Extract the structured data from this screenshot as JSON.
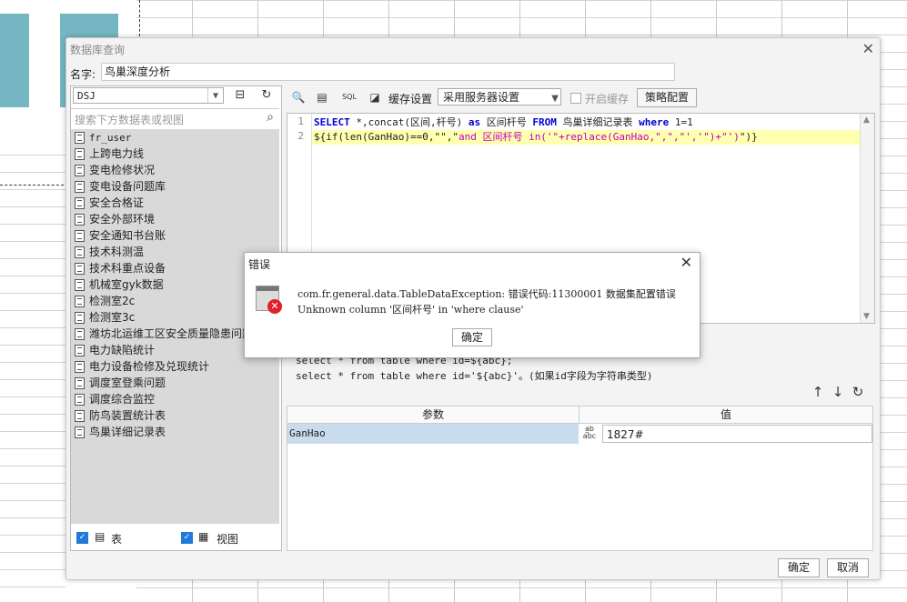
{
  "dialog": {
    "title": "数据库查询",
    "close_icon": "close-icon",
    "name_label": "名字:",
    "name_value": "鸟巢深度分析"
  },
  "left_panel": {
    "db_value": "DSJ",
    "search_placeholder": "搜索下方数据表或视图",
    "tables": [
      {
        "label": "fr_user",
        "mono": true
      },
      {
        "label": "上跨电力线"
      },
      {
        "label": "变电检修状况"
      },
      {
        "label": "变电设备问题库"
      },
      {
        "label": "安全合格证"
      },
      {
        "label": "安全外部环境"
      },
      {
        "label": "安全通知书台账"
      },
      {
        "label": "技术科测温"
      },
      {
        "label": "技术科重点设备"
      },
      {
        "label": "机械室gyk数据"
      },
      {
        "label": "检测室2c"
      },
      {
        "label": "检测室3c"
      },
      {
        "label": "潍坊北运维工区安全质量隐患问题"
      },
      {
        "label": "电力缺陷统计"
      },
      {
        "label": "电力设备检修及兑现统计"
      },
      {
        "label": "调度室登乘问题"
      },
      {
        "label": "调度综合监控"
      },
      {
        "label": "防鸟装置统计表"
      },
      {
        "label": "鸟巢详细记录表"
      }
    ],
    "footer": {
      "table_label": "表",
      "view_label": "视图"
    }
  },
  "toolbar": {
    "cache_label": "缓存设置",
    "cache_option": "采用服务器设置",
    "open_cache_label": "开启缓存",
    "policy_button": "策略配置"
  },
  "editor": {
    "line1_no": "1",
    "line2_no": "2",
    "l1_select": "SELECT",
    "l1_mid": " *,concat(区间,杆号) ",
    "l1_as": "as",
    "l1_alias": " 区间杆号 ",
    "l1_from": "FROM",
    "l1_table": " 鸟巢详细记录表 ",
    "l1_where": "where",
    "l1_cond": " 1=1",
    "l2_a": "${if(len(GanHao)==0,\"\",\"",
    "l2_b": "and 区间杆号 in('\"+replace(GanHao,\",\",\"','\")+\"')",
    "l2_c": "\")}"
  },
  "hints": {
    "line1": "select * from table where id=${abc};",
    "line2": "select * from table where id='${abc}'。(如果id字段为字符串类型)"
  },
  "params": {
    "col_param": "参数",
    "col_value": "值",
    "rows": [
      {
        "name": "GanHao",
        "value": "1827#"
      }
    ]
  },
  "buttons": {
    "ok": "确定",
    "cancel": "取消"
  },
  "error_dialog": {
    "title": "错误",
    "line1": "com.fr.general.data.TableDataException: 错误代码:11300001 数据集配置错误",
    "line2": "Unknown column '区间杆号' in 'where clause'",
    "ok": "确定"
  }
}
